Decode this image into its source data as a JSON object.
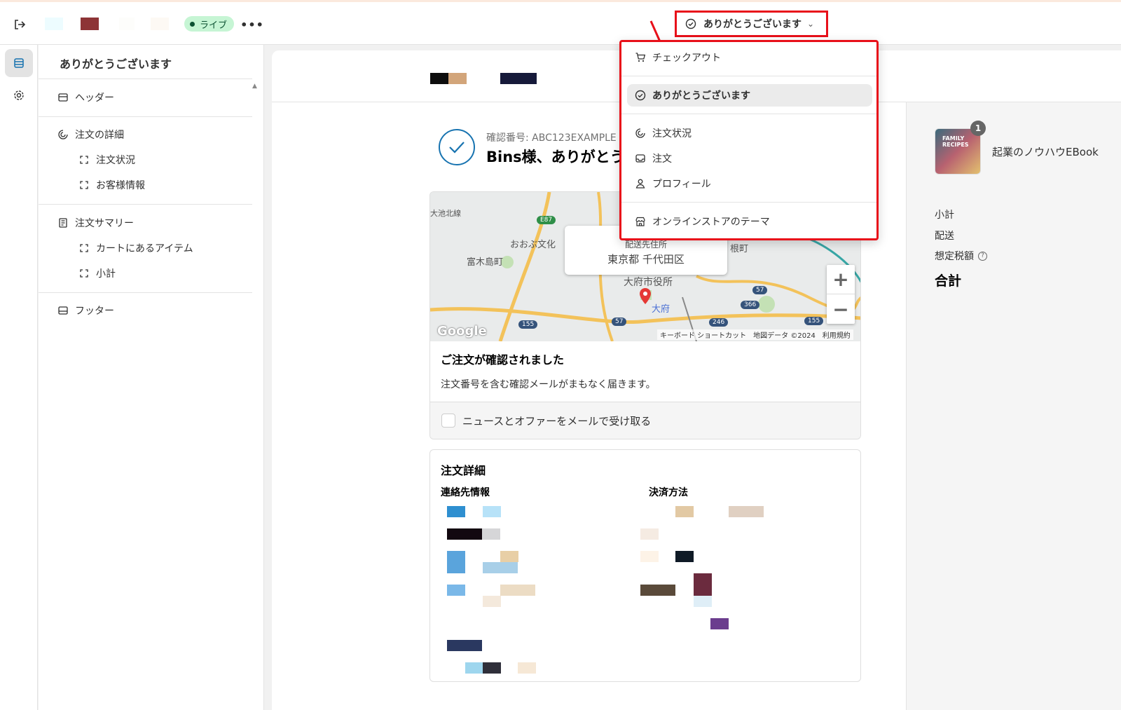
{
  "topbar": {
    "live_label": "ライブ",
    "more_label": "•••",
    "page_select": {
      "label": "ありがとうございます",
      "chevron": "chevron-down-icon"
    }
  },
  "sidebar": {
    "title": "ありがとうございます",
    "header_label": "ヘッダー",
    "order_details_label": "注文の詳細",
    "order_status_label": "注文状況",
    "customer_info_label": "お客様情報",
    "order_summary_label": "注文サマリー",
    "cart_items_label": "カートにあるアイテム",
    "subtotal_label": "小計",
    "footer_label": "フッター"
  },
  "dropdown": {
    "checkout_label": "チェックアウト",
    "thanks_label": "ありがとうございます",
    "order_status_label": "注文状況",
    "orders_label": "注文",
    "profile_label": "プロフィール",
    "theme_label": "オンラインストアのテーマ"
  },
  "preview": {
    "confirmation_number": "確認番号: ABC123EXAMPLE",
    "thanks_heading": "Bins様、ありがとう",
    "map": {
      "tip_title": "配送先住所",
      "tip_address": "東京都 千代田区",
      "zoom_in": "+",
      "zoom_out": "−",
      "google": "Google",
      "footer": "キーボード ショートカット　地図データ ©2024　利用規約",
      "labels": {
        "ooike": "大池北線",
        "ooobu": "おおぶ文化",
        "tomiki": "富木島町",
        "hone": "根町",
        "city_hall": "大府市役所",
        "obu": "大府",
        "e87": "E87",
        "r155a": "155",
        "r57a": "57",
        "r246": "246",
        "r366": "366",
        "r57b": "57",
        "r155b": "155"
      }
    },
    "order_confirmed_title": "ご注文が確認されました",
    "order_confirmed_text": "注文番号を含む確認メールがまもなく届きます。",
    "newsletter_label": "ニュースとオファーをメールで受け取る",
    "order_details_title": "注文詳細",
    "contact_heading": "連絡先情報",
    "payment_heading": "決済方法"
  },
  "summary": {
    "badge": "1",
    "product_name": "起業のノウハウEBook",
    "product_cover_text": "FAMILY RECIPES",
    "subtotal": "小計",
    "shipping": "配送",
    "estimated_tax": "想定税額",
    "total": "合計"
  },
  "colors": {
    "accent": "#1773b0",
    "highlight_red": "#e8101a",
    "live_bg": "#c6f5d4"
  }
}
